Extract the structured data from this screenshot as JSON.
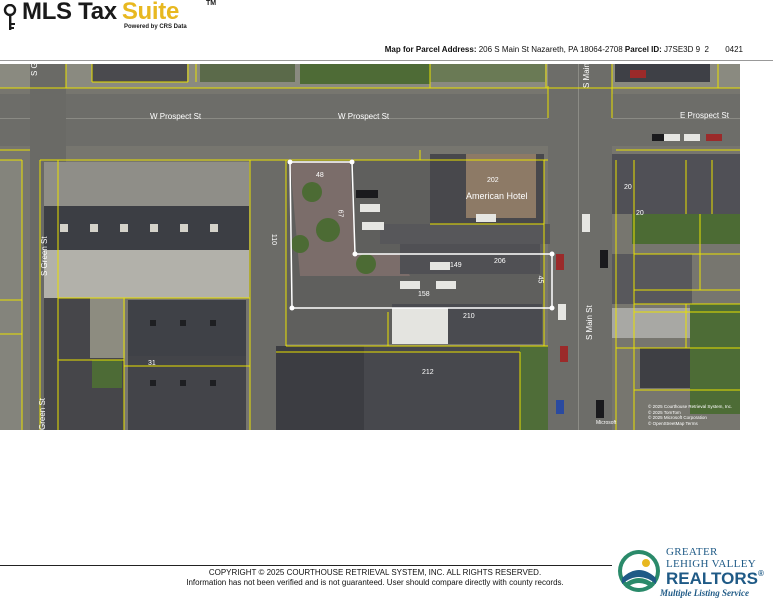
{
  "header": {
    "logo_main": "MLS Tax",
    "logo_accent": "Suite",
    "logo_trademark": "TM",
    "powered_by": "Powered by CRS Data",
    "parcel_label": "Map for Parcel Address:",
    "parcel_address": "206 S Main St Nazareth, PA 18064-2708",
    "parcel_id_label": "Parcel ID:",
    "parcel_id": "J7SE3D 9  2",
    "code": "0421"
  },
  "map": {
    "streets": {
      "prospect_west_1": "W Prospect St",
      "prospect_west_2": "W Prospect St",
      "prospect_east": "E Prospect St",
      "green_top": "S Green St",
      "green_mid": "S Green St",
      "green_bottom": "Green St",
      "main_top": "S Main",
      "main_mid": "S Main St"
    },
    "parcels": {
      "p48": "48",
      "p67": "67",
      "p110": "110",
      "p202": "202",
      "p149": "149",
      "p206": "206",
      "p158": "158",
      "p210": "210",
      "p212": "212",
      "p31": "31",
      "p20a": "20",
      "p20b": "20",
      "p45": "45"
    },
    "building_label": "American Hotel",
    "attribution": [
      "© 2025 Courthouse Retrieval System, Inc.",
      "© 2025 TomTom",
      "© 2025 Microsoft Corporation",
      "© OpenStreetMap  Terms"
    ],
    "provider": "Microsoft",
    "colors": {
      "parcel_line": "#e8e000",
      "subject_outline": "#ffffff",
      "road": "#6f6f6b",
      "roof_dark": "#3e4046",
      "roof_light": "#bdbdb8",
      "grass": "#5c7a3a"
    }
  },
  "footer": {
    "copyright": "COPYRIGHT © 2025 COURTHOUSE RETRIEVAL SYSTEM, INC. ALL RIGHTS RESERVED.",
    "disclaimer": "Information has not been verified and is not guaranteed. User should compare directly with county records.",
    "glvr_line1": "GREATER",
    "glvr_line2": "LEHIGH VALLEY",
    "glvr_line3": "REALTORS",
    "glvr_line4": "Multiple Listing Service"
  }
}
